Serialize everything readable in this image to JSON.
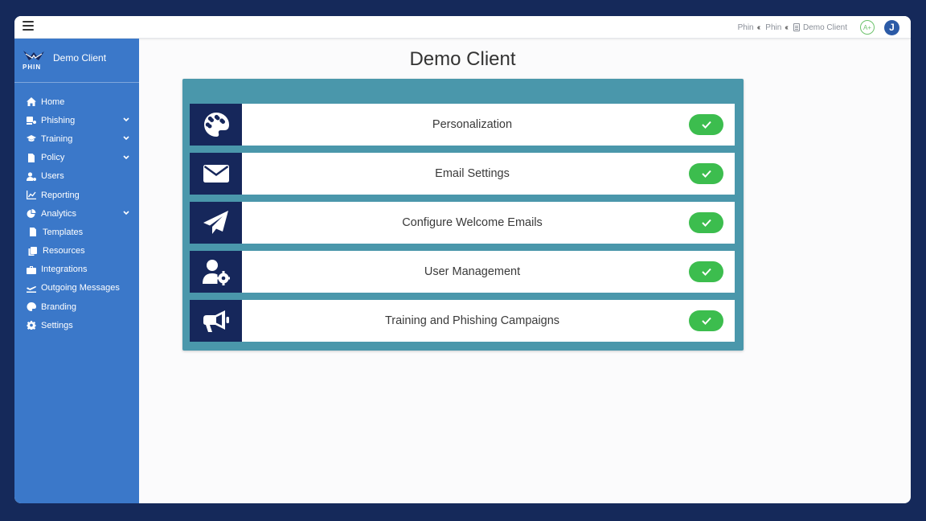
{
  "topbar": {
    "breadcrumbs": [
      {
        "label": "Phin"
      },
      {
        "label": "Phin"
      },
      {
        "label": "Demo Client"
      }
    ],
    "grade": "A+",
    "avatar_initial": "J"
  },
  "sidebar": {
    "brand_wordmark": "PHIN",
    "client_name": "Demo Client",
    "items": [
      {
        "label": "Home",
        "icon": "home-icon",
        "expandable": false
      },
      {
        "label": "Phishing",
        "icon": "phishing-icon",
        "expandable": true
      },
      {
        "label": "Training",
        "icon": "graduation-cap-icon",
        "expandable": true
      },
      {
        "label": "Policy",
        "icon": "file-icon",
        "expandable": true
      },
      {
        "label": "Users",
        "icon": "users-cog-icon",
        "expandable": false
      },
      {
        "label": "Reporting",
        "icon": "chart-line-icon",
        "expandable": false
      },
      {
        "label": "Analytics",
        "icon": "pie-chart-icon",
        "expandable": true
      },
      {
        "label": "Templates",
        "icon": "file-code-icon",
        "expandable": false
      },
      {
        "label": "Resources",
        "icon": "copy-icon",
        "expandable": false
      },
      {
        "label": "Integrations",
        "icon": "toolbox-icon",
        "expandable": false
      },
      {
        "label": "Outgoing Messages",
        "icon": "plane-departure-icon",
        "expandable": false
      },
      {
        "label": "Branding",
        "icon": "palette-icon",
        "expandable": false
      },
      {
        "label": "Settings",
        "icon": "gear-icon",
        "expandable": false
      }
    ]
  },
  "main": {
    "title": "Demo Client",
    "steps": [
      {
        "label": "Personalization",
        "icon": "palette-icon",
        "complete": true
      },
      {
        "label": "Email Settings",
        "icon": "envelope-icon",
        "complete": true
      },
      {
        "label": "Configure Welcome Emails",
        "icon": "paper-plane-icon",
        "complete": true
      },
      {
        "label": "User Management",
        "icon": "user-cog-icon",
        "complete": true
      },
      {
        "label": "Training and Phishing Campaigns",
        "icon": "megaphone-icon",
        "complete": true
      }
    ]
  },
  "colors": {
    "background": "#15295a",
    "sidebar": "#3b78c9",
    "panel": "#4a97ab",
    "step_icon_bg": "#16275b",
    "check_green": "#3cbd4e"
  }
}
